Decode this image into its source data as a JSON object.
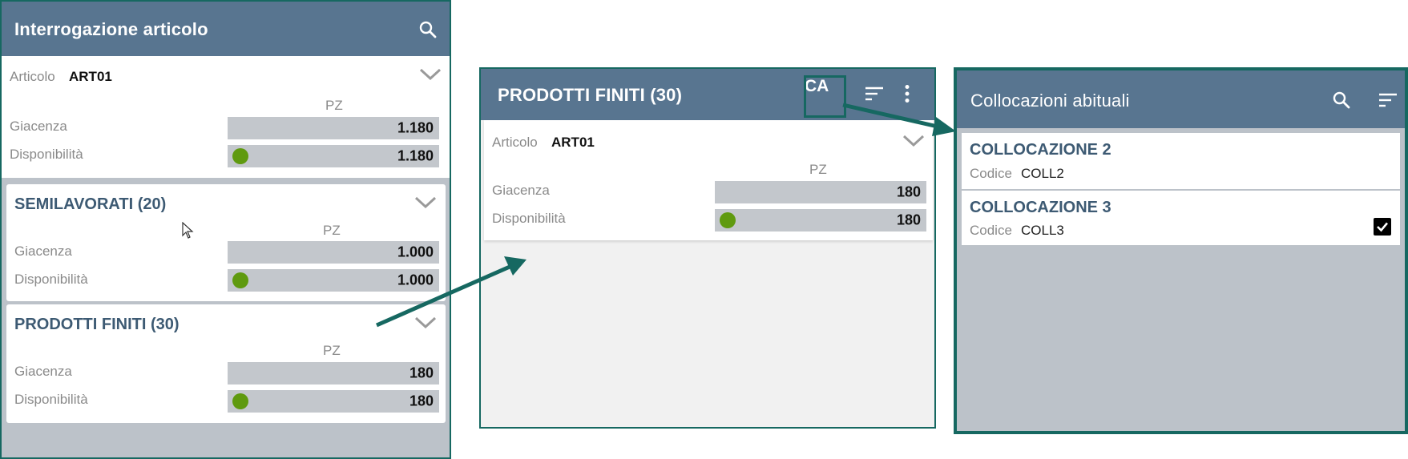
{
  "colors": {
    "appbar": "#587590",
    "frame": "#166861",
    "bar": "#c3c7cc",
    "status_dot": "#5f9a0f",
    "group_title": "#3d5a73"
  },
  "screen1": {
    "title": "Interrogazione articolo",
    "article": {
      "label": "Articolo",
      "value": "ART01"
    },
    "summary": {
      "unit": "PZ",
      "giacenza_label": "Giacenza",
      "giacenza": "1.180",
      "disponibilita_label": "Disponibilità",
      "disponibilita": "1.180"
    },
    "groups": [
      {
        "title": "SEMILAVORATI (20)",
        "unit": "PZ",
        "giacenza_label": "Giacenza",
        "giacenza": "1.000",
        "disponibilita_label": "Disponibilità",
        "disponibilita": "1.000"
      },
      {
        "title": "PRODOTTI FINITI (30)",
        "unit": "PZ",
        "giacenza_label": "Giacenza",
        "giacenza": "180",
        "disponibilita_label": "Disponibilità",
        "disponibilita": "180"
      }
    ]
  },
  "screen2": {
    "title": "PRODOTTI FINITI (30)",
    "action_label": "CA",
    "article": {
      "label": "Articolo",
      "value": "ART01"
    },
    "unit": "PZ",
    "giacenza_label": "Giacenza",
    "giacenza": "180",
    "disponibilita_label": "Disponibilità",
    "disponibilita": "180"
  },
  "screen3": {
    "title": "Collocazioni abituali",
    "items": [
      {
        "name": "COLLOCAZIONE 2",
        "code_label": "Codice",
        "code": "COLL2",
        "checked": false
      },
      {
        "name": "COLLOCAZIONE 3",
        "code_label": "Codice",
        "code": "COLL3",
        "checked": true
      }
    ]
  }
}
